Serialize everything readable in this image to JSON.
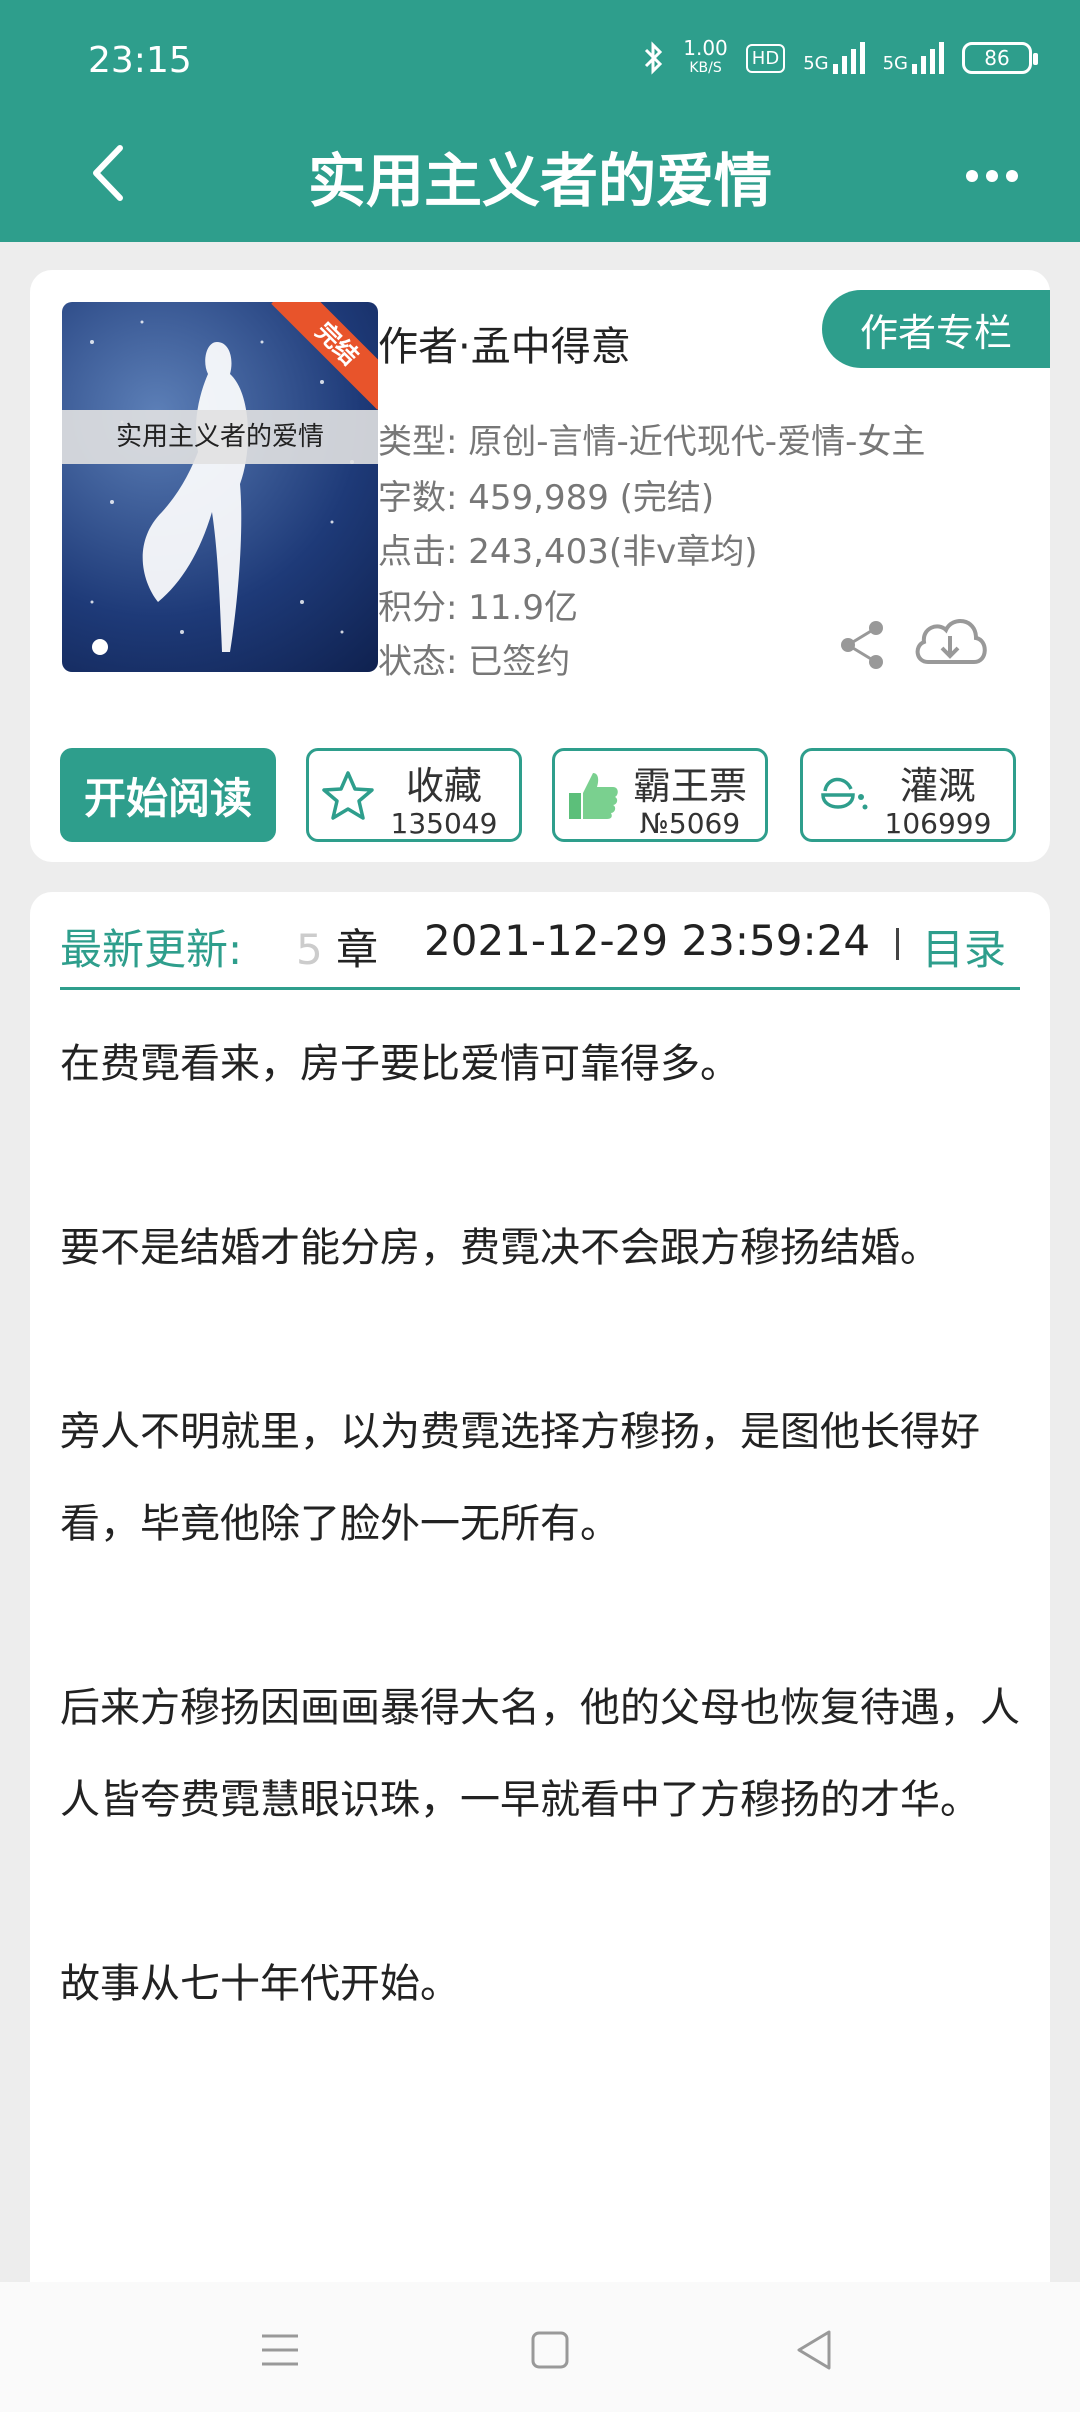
{
  "status": {
    "time": "23:15",
    "net_speed": "1.00",
    "net_unit": "KB/S",
    "hd": "HD",
    "net1": "5G",
    "net2": "5G",
    "battery": "86"
  },
  "nav": {
    "title": "实用主义者的爱情"
  },
  "book": {
    "cover_title": "实用主义者的爱情",
    "cover_ribbon": "完结",
    "author": "作者·孟中得意",
    "author_column_label": "作者专栏",
    "genre": "类型: 原创-言情-近代现代-爱情-女主",
    "words": "字数: 459,989 (完结)",
    "clicks": "点击: 243,403(非v章均)",
    "score": "积分: 11.9亿",
    "status": "状态: 已签约"
  },
  "actions": {
    "read_label": "开始阅读",
    "collect_label": "收藏",
    "collect_count": "135049",
    "ticket_label": "霸王票",
    "ticket_count": "№5069",
    "water_label": "灌溉",
    "water_count": "106999"
  },
  "update": {
    "label": "最新更新:",
    "chapter_prefix": "5",
    "chapter_suffix": "章",
    "time": "2021-12-29 23:59:24",
    "toc_label": "目录"
  },
  "blurb": [
    "在费霓看来，房子要比爱情可靠得多。",
    "要不是结婚才能分房，费霓决不会跟方穆扬结婚。",
    "旁人不明就里，以为费霓选择方穆扬，是图他长得好看，毕竟他除了脸外一无所有。",
    "后来方穆扬因画画暴得大名，他的父母也恢复待遇，人人皆夸费霓慧眼识珠，一早就看中了方穆扬的才华。",
    "故事从七十年代开始。"
  ],
  "colors": {
    "brand": "#2e9e8c",
    "ribbon": "#e8542b"
  }
}
